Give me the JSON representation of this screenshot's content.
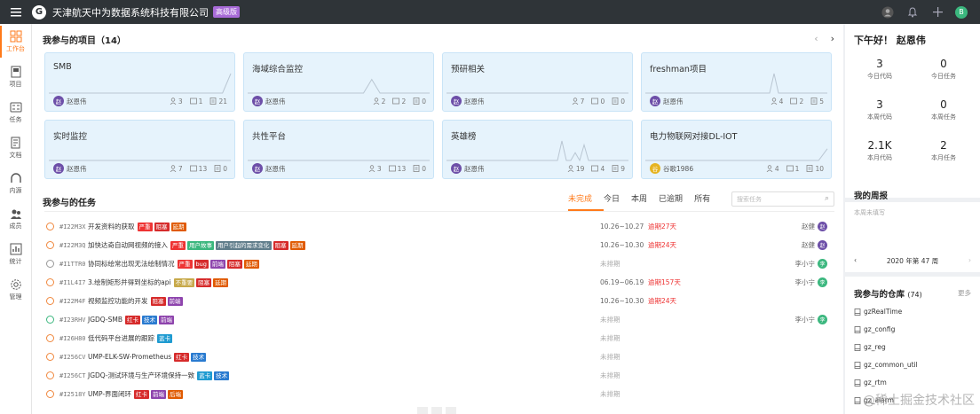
{
  "topbar": {
    "company": "天津航天中为数据系统科技有限公司",
    "edition": "高级版",
    "avatar": "B"
  },
  "nav": [
    {
      "label": "工作台",
      "icon": "dashboard-icon",
      "active": true
    },
    {
      "label": "项目",
      "icon": "project-icon"
    },
    {
      "label": "任务",
      "icon": "task-icon"
    },
    {
      "label": "文档",
      "icon": "document-icon"
    },
    {
      "label": "内源",
      "icon": "inner-source-icon"
    },
    {
      "label": "成员",
      "icon": "members-icon"
    },
    {
      "label": "统计",
      "icon": "statistics-icon"
    },
    {
      "label": "管理",
      "icon": "settings-icon"
    }
  ],
  "projects": {
    "title": "我参与的项目（14）",
    "prev": "‹",
    "next": "›",
    "items": [
      {
        "name": "SMB",
        "owner": "赵恩伟",
        "av": "赵",
        "s1": "3",
        "s2": "1",
        "s3": "21",
        "spark": [
          0,
          0,
          0,
          0,
          0,
          0,
          0,
          0,
          0,
          0,
          0,
          0,
          0,
          0,
          0,
          0,
          0,
          0,
          0,
          0,
          0,
          0,
          1
        ]
      },
      {
        "name": "海域综合监控",
        "owner": "赵恩伟",
        "av": "赵",
        "s1": "2",
        "s2": "2",
        "s3": "0",
        "spark": [
          0,
          0,
          0,
          0,
          0,
          0,
          0,
          0,
          0,
          0,
          0,
          0,
          0,
          0,
          0,
          0.7,
          0,
          0,
          0,
          0,
          0,
          0,
          0
        ]
      },
      {
        "name": "预研相关",
        "owner": "赵恩伟",
        "av": "赵",
        "s1": "7",
        "s2": "0",
        "s3": "0",
        "spark": [
          0,
          0,
          0,
          0,
          0,
          0,
          0,
          0,
          0,
          0,
          0,
          0,
          0,
          0,
          0,
          0,
          0,
          0,
          0,
          0,
          0,
          0,
          0
        ]
      },
      {
        "name": "freshman项目",
        "owner": "赵恩伟",
        "av": "赵",
        "s1": "4",
        "s2": "2",
        "s3": "5",
        "spark": [
          0,
          0,
          0,
          0,
          0,
          0,
          0,
          0,
          0,
          0,
          0,
          0,
          0,
          0,
          0,
          0,
          0,
          0,
          0,
          0,
          0,
          0,
          0,
          0,
          0,
          0,
          0,
          0,
          0,
          1,
          0,
          0,
          0,
          0,
          0,
          0,
          0,
          0,
          0,
          0,
          0,
          0
        ]
      },
      {
        "name": "实时监控",
        "owner": "赵恩伟",
        "av": "赵",
        "s1": "7",
        "s2": "13",
        "s3": "0",
        "spark": [
          0,
          0,
          0,
          0,
          0,
          0,
          0,
          0,
          0,
          0,
          0,
          0,
          0,
          0,
          0,
          0,
          0,
          0,
          0,
          0,
          0,
          0,
          0
        ]
      },
      {
        "name": "共性平台",
        "owner": "赵恩伟",
        "av": "赵",
        "s1": "3",
        "s2": "13",
        "s3": "0",
        "spark": [
          0,
          0,
          0,
          0,
          0,
          0,
          0,
          0,
          0,
          0,
          0,
          0,
          0,
          0,
          0,
          0,
          0,
          0,
          0,
          0,
          0,
          0,
          0
        ]
      },
      {
        "name": "英雄榜",
        "owner": "赵恩伟",
        "av": "赵",
        "s1": "19",
        "s2": "4",
        "s3": "9",
        "spark": [
          0,
          0,
          0,
          0,
          0,
          0,
          0,
          0,
          0,
          0,
          0,
          0,
          0,
          0,
          0,
          0,
          0,
          0,
          0,
          0,
          0,
          0,
          0,
          0,
          0,
          0,
          1,
          0,
          0,
          0.4,
          0,
          0.8,
          0,
          0,
          0,
          0,
          0,
          0,
          0,
          0,
          0,
          0
        ]
      },
      {
        "name": "电力物联网对接DL-IOT",
        "owner": "谷歌1986",
        "av": "谷",
        "gold": true,
        "s1": "4",
        "s2": "1",
        "s3": "10",
        "spark": [
          0,
          0,
          0,
          0,
          0,
          0,
          0,
          0,
          0,
          0,
          0,
          0,
          0,
          0,
          0,
          0,
          0,
          0,
          0,
          0,
          0,
          0.6
        ]
      }
    ]
  },
  "tasks": {
    "title": "我参与的任务",
    "tabs": [
      "未完成",
      "今日",
      "本周",
      "已逾期",
      "所有"
    ],
    "search_placeholder": "搜索任务",
    "items": [
      {
        "id": "#I22M3X",
        "title": "开发资料的获取",
        "tags": [
          [
            "严重",
            "#e33"
          ],
          [
            "阻塞",
            "#d62b2b"
          ],
          [
            "延期",
            "#e05a00"
          ]
        ],
        "date": "10.26~10.27",
        "over": "逾期27天",
        "user": "赵健",
        "uav": "赵",
        "uc": "#6d4fa8",
        "st": ""
      },
      {
        "id": "#I22M3Q",
        "title": "加快达奇自动网视频的接入",
        "tags": [
          [
            "严重",
            "#e33"
          ],
          [
            "用户故事",
            "#3bb77e"
          ],
          [
            "用户引起的需求变化",
            "#607d8b"
          ],
          [
            "阻塞",
            "#d62b2b"
          ],
          [
            "延期",
            "#e05a00"
          ]
        ],
        "date": "10.26~10.30",
        "over": "逾期24天",
        "user": "赵健",
        "uav": "赵",
        "uc": "#6d4fa8",
        "st": ""
      },
      {
        "id": "#I1TTR0",
        "title": "协同标绘常出现无法绘制情况",
        "tags": [
          [
            "严重",
            "#e33"
          ],
          [
            "bug",
            "#d62b2b"
          ],
          [
            "前端",
            "#8e44ad"
          ],
          [
            "阻塞",
            "#d62b2b"
          ],
          [
            "延期",
            "#e05a00"
          ]
        ],
        "date": "未排期",
        "over": "",
        "user": "李小宁",
        "uav": "李",
        "uc": "#3bb77e",
        "st": "done"
      },
      {
        "id": "#I1L4I7",
        "title": "3.绘制矩形并得到坐标的api",
        "tags": [
          [
            "不重要",
            "#c7a94a"
          ],
          [
            "阻塞",
            "#d62b2b"
          ],
          [
            "延期",
            "#e05a00"
          ]
        ],
        "date": "06.19~06.19",
        "over": "逾期157天",
        "user": "李小宁",
        "uav": "李",
        "uc": "#3bb77e",
        "st": ""
      },
      {
        "id": "#I22M4F",
        "title": "视频监控功能的开发",
        "tags": [
          [
            "阻塞",
            "#d62b2b"
          ],
          [
            "前端",
            "#8e44ad"
          ]
        ],
        "date": "10.26~10.30",
        "over": "逾期24天",
        "user": "",
        "uav": "",
        "uc": "",
        "st": ""
      },
      {
        "id": "#I23RHV",
        "title": "JGDQ-SMB",
        "tags": [
          [
            "红卡",
            "#d62b2b"
          ],
          [
            "技术",
            "#2a7bd0"
          ],
          [
            "前端",
            "#8e44ad"
          ]
        ],
        "date": "未排期",
        "over": "",
        "user": "李小宁",
        "uav": "李",
        "uc": "#3bb77e",
        "st": "prog"
      },
      {
        "id": "#I26H80",
        "title": "低代码平台进展的跟踪",
        "tags": [
          [
            "蓝卡",
            "#1f9bd1"
          ]
        ],
        "date": "未排期",
        "over": "",
        "user": "",
        "uav": "",
        "uc": "",
        "st": ""
      },
      {
        "id": "#I256CV",
        "title": "UMP-ELK-SW-Prometheus",
        "tags": [
          [
            "红卡",
            "#d62b2b"
          ],
          [
            "技术",
            "#2a7bd0"
          ]
        ],
        "date": "未排期",
        "over": "",
        "user": "",
        "uav": "",
        "uc": "",
        "st": ""
      },
      {
        "id": "#I256CT",
        "title": "JGDQ-测试环境与生产环境保持一致",
        "tags": [
          [
            "蓝卡",
            "#1f9bd1"
          ],
          [
            "技术",
            "#2a7bd0"
          ]
        ],
        "date": "未排期",
        "over": "",
        "user": "",
        "uav": "",
        "uc": "",
        "st": ""
      },
      {
        "id": "#I2518Y",
        "title": "UMP-界面闭环",
        "tags": [
          [
            "红卡",
            "#d62b2b"
          ],
          [
            "前端",
            "#8e44ad"
          ],
          [
            "后端",
            "#e05a00"
          ]
        ],
        "date": "未排期",
        "over": "",
        "user": "",
        "uav": "",
        "uc": "",
        "st": ""
      }
    ]
  },
  "sidebar": {
    "greeting": "下午好！ 赵恩伟",
    "stats": [
      {
        "num": "3",
        "label": "今日代码"
      },
      {
        "num": "0",
        "label": "今日任务"
      },
      {
        "num": "3",
        "label": "本周代码"
      },
      {
        "num": "0",
        "label": "本周任务"
      },
      {
        "num": "2.1K",
        "label": "本月代码"
      },
      {
        "num": "2",
        "label": "本月任务"
      }
    ],
    "weekly_title": "我的周报",
    "weekly_note": "本周未填写",
    "week_label": "2020 年第 47 周",
    "week_prev": "‹",
    "week_next": "›",
    "repos_title": "我参与的仓库",
    "repos_count": "(74)",
    "repos_more": "更多",
    "repos": [
      "gzRealTime",
      "gz_config",
      "gz_reg",
      "gz_common_util",
      "gz_rtm",
      "gz_alarm"
    ]
  },
  "watermark": "@稀土掘金技术社区"
}
